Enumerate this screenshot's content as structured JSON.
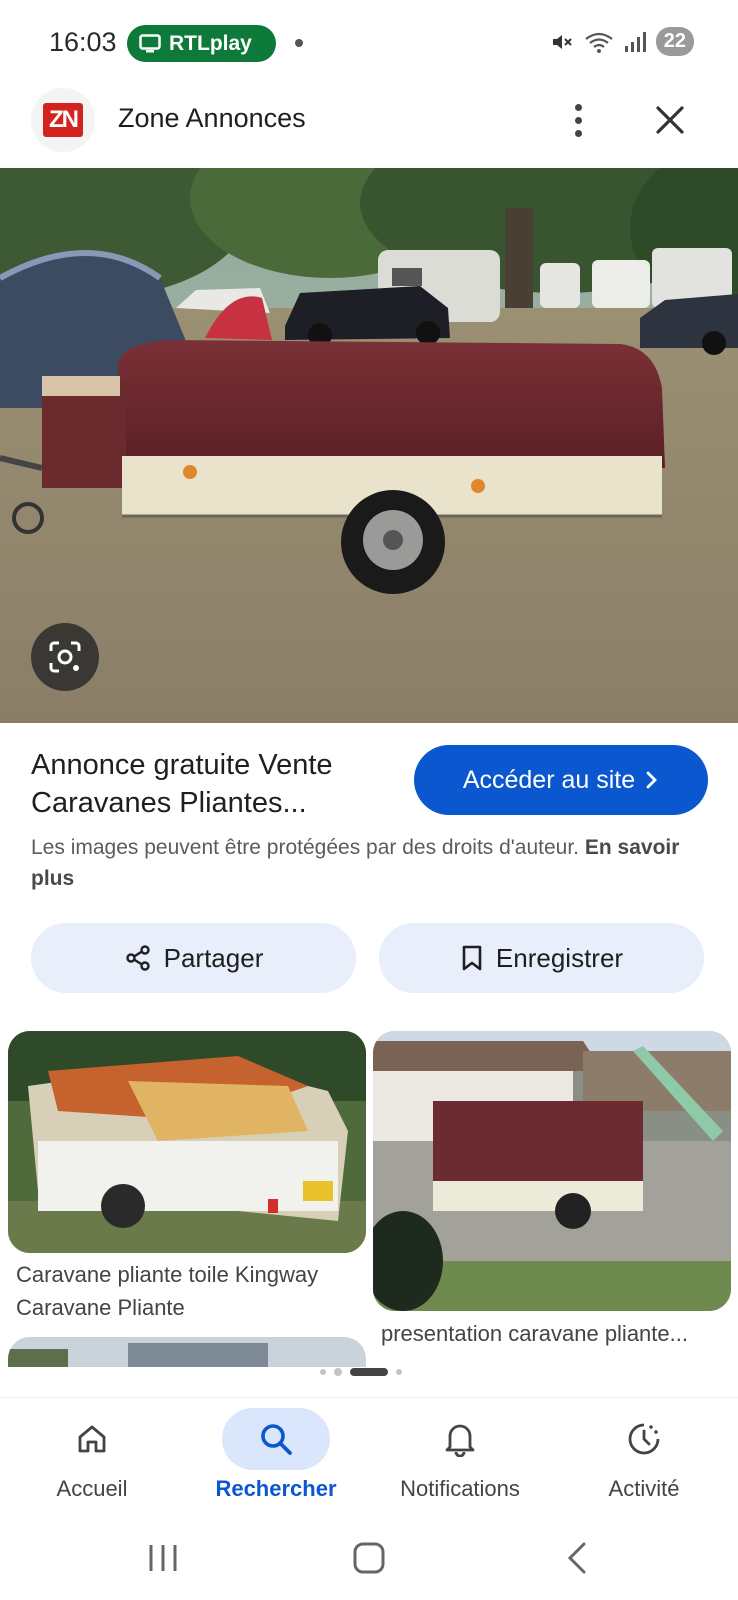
{
  "status_bar": {
    "time": "16:03",
    "active_app_pill": "RTLplay",
    "battery_level": "22",
    "pill_color": "#0e7a3a"
  },
  "header": {
    "site_logo_text": "ZN",
    "site_name": "Zone Annonces"
  },
  "main_image": {
    "icon": "lens-icon"
  },
  "result": {
    "title": "Annonce gratuite Vente Caravanes Pliantes...",
    "visit_button": "Accéder au site",
    "copyright_text": "Les images peuvent être protégées par des droits d'auteur.",
    "learn_more": "En savoir plus",
    "share_button": "Partager",
    "save_button": "Enregistrer"
  },
  "related": [
    {
      "caption": "Caravane pliante toile Kingway Caravane Pliante"
    },
    {
      "caption": "presentation caravane pliante..."
    }
  ],
  "bottom_nav": [
    {
      "label": "Accueil",
      "icon": "home-icon",
      "active": false
    },
    {
      "label": "Rechercher",
      "icon": "search-icon",
      "active": true
    },
    {
      "label": "Notifications",
      "icon": "bell-icon",
      "active": false
    },
    {
      "label": "Activité",
      "icon": "activity-icon",
      "active": false
    }
  ],
  "colors": {
    "accent": "#0b57d0",
    "chip_bg": "#e8eefa",
    "trailer_cover": "#6e2a2e"
  }
}
